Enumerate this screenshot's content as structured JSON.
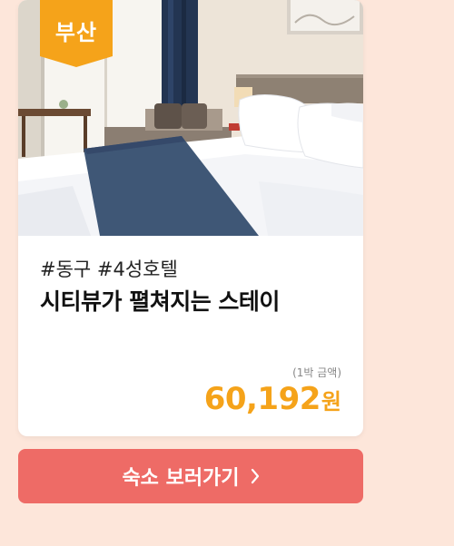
{
  "card": {
    "region_badge": "부산",
    "tags": "#동구 #4성호텔",
    "title": "시티뷰가 펼쳐지는 스테이",
    "price_note": "(1박 금액)",
    "price_value": "60,192",
    "price_unit": "원"
  },
  "cta": {
    "label": "숙소 보러가기"
  },
  "icons": {
    "cta_arrow": "chevron-right-icon"
  },
  "colors": {
    "background": "#fde6da",
    "badge": "#f5a31a",
    "price": "#f5a31a",
    "cta": "#ee6b66",
    "blanket_runner": "#3f5776"
  }
}
